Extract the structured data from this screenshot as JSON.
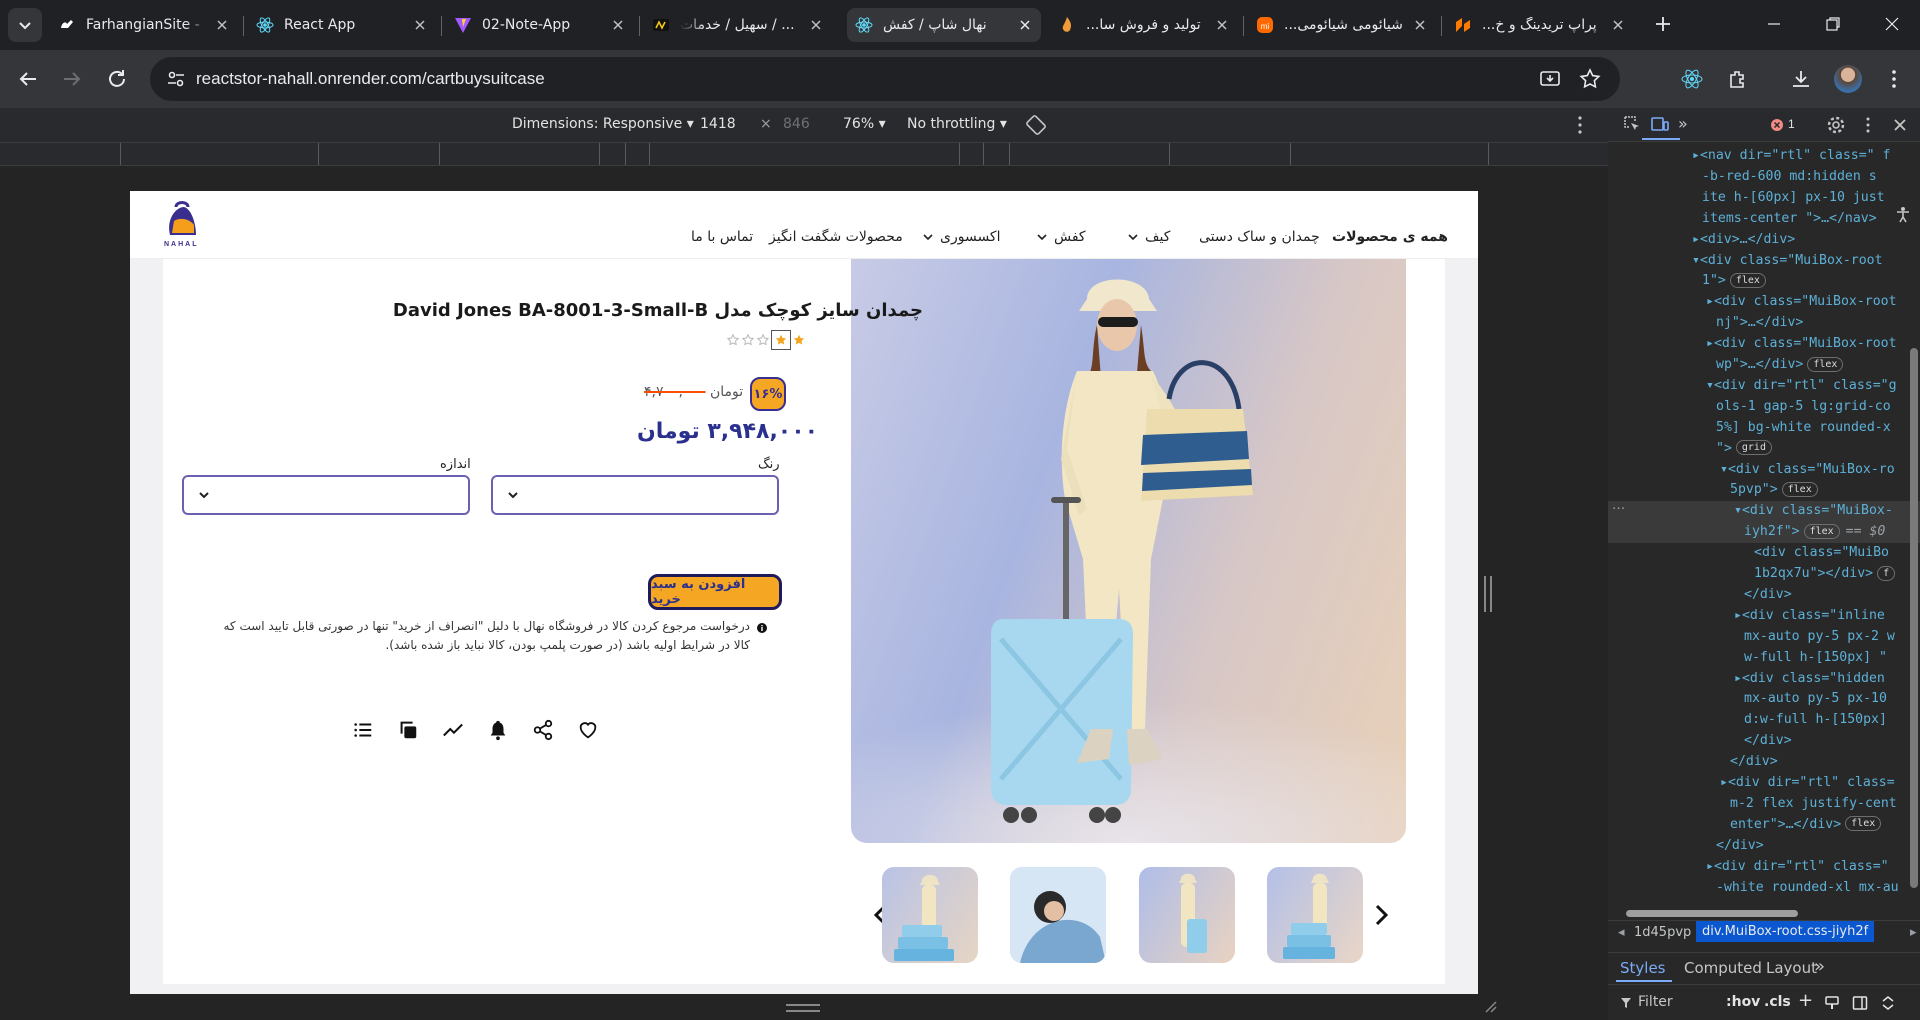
{
  "browser": {
    "tabs": [
      {
        "title": "FarhangianSite -",
        "icon": "vercel-icon",
        "active": false
      },
      {
        "title": "React App",
        "icon": "react-icon",
        "active": false
      },
      {
        "title": "02-Note-App",
        "icon": "vite-icon",
        "active": false
      },
      {
        "title": "سهیل / خدمات / ...",
        "icon": "dashboard-icon",
        "active": false
      },
      {
        "title": "نهال شاپ / کفش",
        "icon": "react-icon",
        "active": true
      },
      {
        "title": "تولید و فروش سا...",
        "icon": "flame-icon",
        "active": false
      },
      {
        "title": "شیائومی شیائومی...",
        "icon": "mi-icon",
        "active": false
      },
      {
        "title": "پراپ تریدینگ و خ...",
        "icon": "prop-icon",
        "active": false
      }
    ],
    "url": "reactstor-nahall.onrender.com/cartbuysuitcase"
  },
  "device_toolbar": {
    "dimensions_label": "Dimensions: Responsive",
    "width": "1418",
    "height": "846",
    "zoom": "76%",
    "throttling": "No throttling"
  },
  "site": {
    "logo_text": "NAHAL",
    "nav": [
      {
        "label": "همه ی محصولات",
        "dropdown": false
      },
      {
        "label": "چمدان و ساک دستی",
        "dropdown": false
      },
      {
        "label": "کیف",
        "dropdown": true
      },
      {
        "label": "کفش",
        "dropdown": true
      },
      {
        "label": "اکسسوری",
        "dropdown": true
      },
      {
        "label": "محصولات شگفت انگیز",
        "dropdown": false
      },
      {
        "label": "تماس با ما",
        "dropdown": false
      }
    ],
    "product": {
      "title": "چمدان سایز کوچک مدل David Jones BA-8001-3-Small-B",
      "rating": 1,
      "rating_max": 5,
      "discount_badge": "۱۶%",
      "old_price": "۴,۷۰۰,۰۰۰",
      "old_price_unit": "تومان",
      "price": "۳,۹۴۸,۰۰۰ تومان",
      "color_label": "رنگ",
      "size_label": "اندازه",
      "add_to_cart": "افزودن به سبد خرید",
      "notice_line1": "درخواست مرجوع کردن کالا در فروشگاه نهال با دلیل \"انصراف از خرید\" تنها در صورتی قابل تایید است که",
      "notice_line2": "کالا در شرایط اولیه باشد (در صورت پلمپ بودن، کالا نباید باز شده باشد)."
    },
    "actions": [
      "list-icon",
      "copy-icon",
      "chart-icon",
      "bell-icon",
      "share-icon",
      "heart-icon"
    ],
    "thumbnails": 4
  },
  "devtools": {
    "error_count": "1",
    "elements": [
      {
        "text": "▸<nav dir=\"rtl\" class=\" f",
        "indent": 84
      },
      {
        "text": "-b-red-600 md:hidden s",
        "indent": 94
      },
      {
        "text": "ite h-[60px] px-10  just",
        "indent": 94
      },
      {
        "text": "items-center \">…</nav>",
        "indent": 94
      },
      {
        "text": "▸<div>…</div>",
        "indent": 84
      },
      {
        "text": "▾<div class=\"MuiBox-root",
        "indent": 84
      },
      {
        "text": "1\">",
        "badge": "flex",
        "indent": 94
      },
      {
        "text": "▸<div class=\"MuiBox-root",
        "indent": 98
      },
      {
        "text": "nj\">…</div>",
        "indent": 108
      },
      {
        "text": "▸<div class=\"MuiBox-root",
        "indent": 98
      },
      {
        "text": "wp\">…</div>",
        "badge": "flex",
        "indent": 108
      },
      {
        "text": "▾<div dir=\"rtl\" class=\"g",
        "indent": 98
      },
      {
        "text": "ols-1 gap-5 lg:grid-co",
        "indent": 108
      },
      {
        "text": "5%] bg-white rounded-x",
        "indent": 108
      },
      {
        "text": "\">",
        "badge": "grid",
        "indent": 108
      },
      {
        "text": "▾<div class=\"MuiBox-ro",
        "indent": 112
      },
      {
        "text": "5pvp\">",
        "badge": "flex",
        "indent": 122
      },
      {
        "text": "▾<div class=\"MuiBox-",
        "indent": 126,
        "selected": true
      },
      {
        "text": "iyh2f\">",
        "badge": "flex",
        "suffix": "== $0",
        "indent": 136,
        "selected": true
      },
      {
        "text": "<div class=\"MuiBo",
        "indent": 146
      },
      {
        "text": "1b2qx7u\"></div>",
        "badge": "f",
        "indent": 146
      },
      {
        "text": "</div>",
        "indent": 136
      },
      {
        "text": "▸<div class=\"inline",
        "indent": 126
      },
      {
        "text": "mx-auto py-5 px-2 w",
        "indent": 136
      },
      {
        "text": "w-full  h-[150px] \"",
        "indent": 136
      },
      {
        "text": "▸<div class=\"hidden",
        "indent": 126
      },
      {
        "text": "mx-auto py-5 px-10",
        "indent": 136
      },
      {
        "text": "d:w-full  h-[150px]",
        "indent": 136
      },
      {
        "text": "</div>",
        "indent": 136
      },
      {
        "text": "</div>",
        "indent": 122
      },
      {
        "text": "▸<div dir=\"rtl\" class=",
        "indent": 112
      },
      {
        "text": "m-2 flex justify-cent",
        "indent": 122
      },
      {
        "text": "enter\">…</div>",
        "badge": "flex",
        "indent": 122
      },
      {
        "text": "</div>",
        "indent": 108
      },
      {
        "text": "▸<div dir=\"rtl\" class=\"",
        "indent": 98
      },
      {
        "text": "-white rounded-xl mx-au",
        "indent": 108
      }
    ],
    "breadcrumb_prev": "1d45pvp",
    "breadcrumb_current": "div.MuiBox-root.css-jiyh2f",
    "panel_tabs": [
      "Styles",
      "Computed",
      "Layout"
    ],
    "filter_placeholder": "Filter",
    "hov": ":hov",
    "cls": ".cls"
  }
}
